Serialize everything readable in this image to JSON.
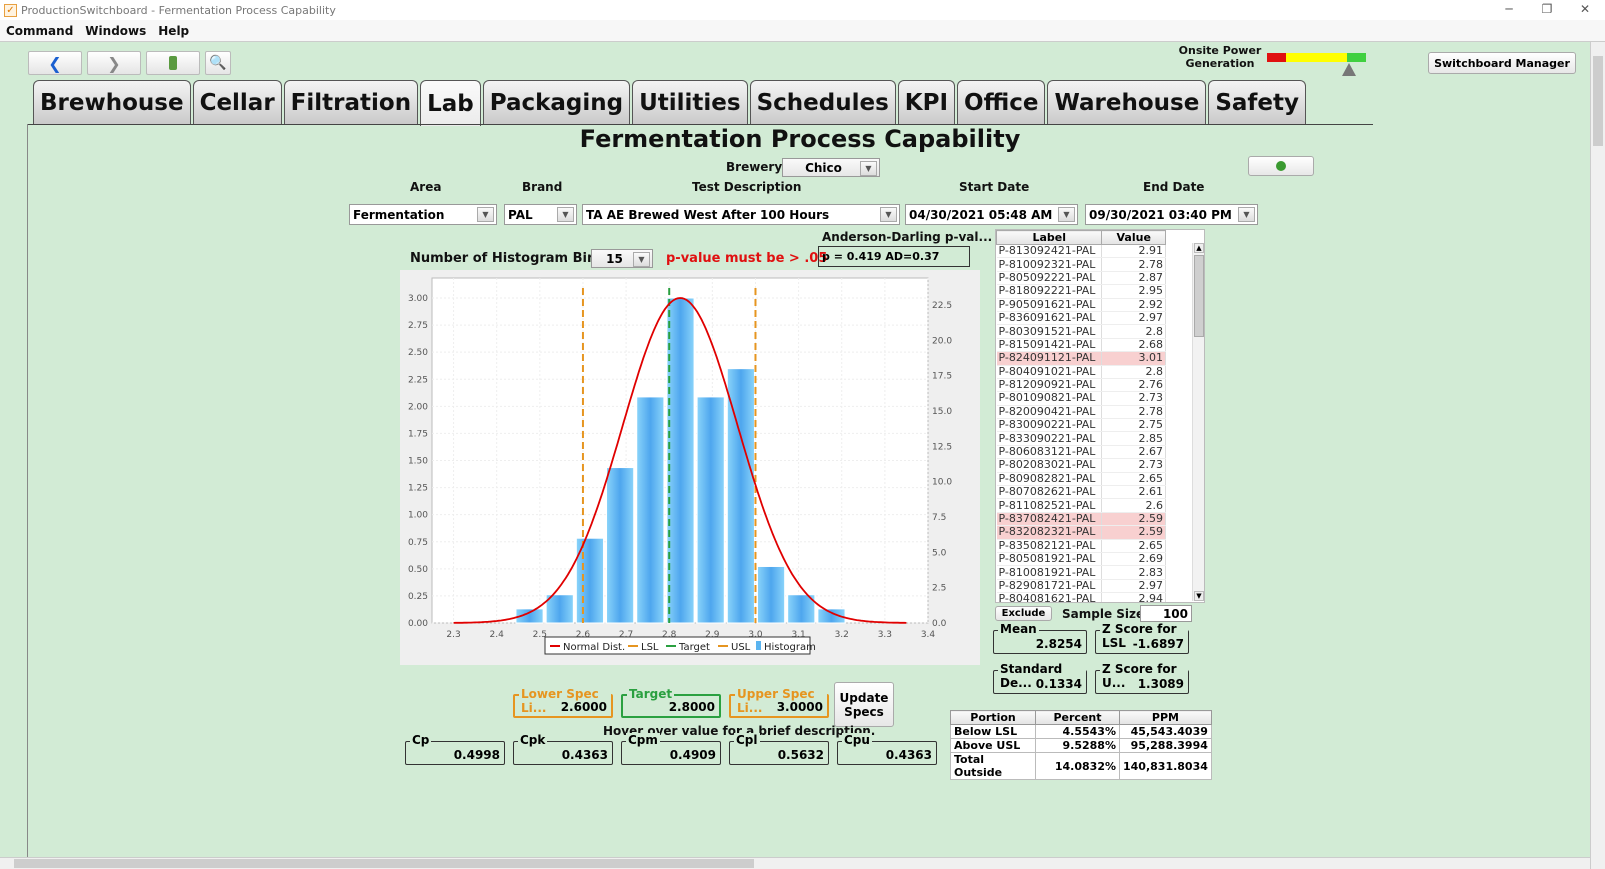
{
  "window": {
    "title": "ProductionSwitchboard - Fermentation Process Capability"
  },
  "menu": [
    "Command",
    "Windows",
    "Help"
  ],
  "toolbar": {
    "back_icon": "back-arrow-icon",
    "forward_icon": "forward-arrow-icon",
    "battery_icon": "battery-icon",
    "search_icon": "magnifier-icon"
  },
  "power": {
    "label_line1": "Onsite Power",
    "label_line2": "Generation",
    "level_fraction": 0.83
  },
  "switchboard_manager": "Switchboard Manager",
  "tabs": [
    "Brewhouse",
    "Cellar",
    "Filtration",
    "Lab",
    "Packaging",
    "Utilities",
    "Schedules",
    "KPI",
    "Office",
    "Warehouse",
    "Safety"
  ],
  "active_tab": "Lab",
  "page_title": "Fermentation Process Capability",
  "filters": {
    "brewery_label": "Brewery",
    "brewery_value": "Chico",
    "area_label": "Area",
    "area_value": "Fermentation",
    "brand_label": "Brand",
    "brand_value": "PAL",
    "test_label": "Test Description",
    "test_value": "TA AE Brewed West After 100 Hours",
    "start_label": "Start Date",
    "start_value": "04/30/2021 05:48 AM",
    "end_label": "End Date",
    "end_value": "09/30/2021 03:40 PM"
  },
  "bins": {
    "label": "Number of Histogram Bins:",
    "value": "15"
  },
  "pvalue_warning": "p-value must be > .05",
  "ad": {
    "label": "Anderson-Darling p-val...",
    "value": "p = 0.419 AD=0.37"
  },
  "chart_data": {
    "type": "bar",
    "title": "",
    "xlabel": "",
    "ylabel": "",
    "x_ticks": [
      "2.3",
      "2.4",
      "2.5",
      "2.6",
      "2.7",
      "2.8",
      "2.9",
      "3.0",
      "3.1",
      "3.2",
      "3.3",
      "3.4"
    ],
    "xlim": [
      2.25,
      3.4
    ],
    "y_left_ticks": [
      "0.00",
      "0.25",
      "0.50",
      "0.75",
      "1.00",
      "1.25",
      "1.50",
      "1.75",
      "2.00",
      "2.25",
      "2.50",
      "2.75",
      "3.00"
    ],
    "ylim_left": [
      0,
      3.0
    ],
    "y_right_ticks": [
      "0.0",
      "2.5",
      "5.0",
      "7.5",
      "10.0",
      "12.5",
      "15.0",
      "17.5",
      "20.0",
      "22.5"
    ],
    "ylim_right": [
      0,
      23.0
    ],
    "histogram": {
      "bin_starts": [
        2.44,
        2.51,
        2.58,
        2.65,
        2.72,
        2.79,
        2.86,
        2.93,
        3.0,
        3.07,
        3.14
      ],
      "bin_width": 0.07,
      "heights": [
        1,
        2,
        6,
        11,
        16,
        23,
        16,
        18,
        4,
        2,
        1
      ]
    },
    "normal": {
      "mean": 2.8254,
      "sd": 0.1334,
      "peak_left_axis": 3.0
    },
    "lsl": 2.6,
    "target": 2.8,
    "usl": 3.0,
    "legend": [
      "Normal Dist.",
      "LSL",
      "Target",
      "USL",
      "Histogram"
    ],
    "legend_position": "bottom",
    "grid": true,
    "colors": {
      "normal": "#e00000",
      "lsl": "#e69520",
      "target": "#2aa040",
      "usl": "#e69520",
      "bar": "#5ab4f0"
    }
  },
  "table": {
    "headers": [
      "Label",
      "Value"
    ],
    "rows": [
      {
        "label": "P-813092421-PAL",
        "value": "2.91",
        "hl": false
      },
      {
        "label": "P-810092321-PAL",
        "value": "2.78",
        "hl": false
      },
      {
        "label": "P-805092221-PAL",
        "value": "2.87",
        "hl": false
      },
      {
        "label": "P-818092221-PAL",
        "value": "2.95",
        "hl": false
      },
      {
        "label": "P-905091621-PAL",
        "value": "2.92",
        "hl": false
      },
      {
        "label": "P-836091621-PAL",
        "value": "2.97",
        "hl": false
      },
      {
        "label": "P-803091521-PAL",
        "value": "2.8",
        "hl": false
      },
      {
        "label": "P-815091421-PAL",
        "value": "2.68",
        "hl": false
      },
      {
        "label": "P-824091121-PAL",
        "value": "3.01",
        "hl": true
      },
      {
        "label": "P-804091021-PAL",
        "value": "2.8",
        "hl": false
      },
      {
        "label": "P-812090921-PAL",
        "value": "2.76",
        "hl": false
      },
      {
        "label": "P-801090821-PAL",
        "value": "2.73",
        "hl": false
      },
      {
        "label": "P-820090421-PAL",
        "value": "2.78",
        "hl": false
      },
      {
        "label": "P-830090221-PAL",
        "value": "2.75",
        "hl": false
      },
      {
        "label": "P-833090221-PAL",
        "value": "2.85",
        "hl": false
      },
      {
        "label": "P-806083121-PAL",
        "value": "2.67",
        "hl": false
      },
      {
        "label": "P-802083021-PAL",
        "value": "2.73",
        "hl": false
      },
      {
        "label": "P-809082821-PAL",
        "value": "2.65",
        "hl": false
      },
      {
        "label": "P-807082621-PAL",
        "value": "2.61",
        "hl": false
      },
      {
        "label": "P-811082521-PAL",
        "value": "2.6",
        "hl": false
      },
      {
        "label": "P-837082421-PAL",
        "value": "2.59",
        "hl": true
      },
      {
        "label": "P-832082321-PAL",
        "value": "2.59",
        "hl": true
      },
      {
        "label": "P-835082121-PAL",
        "value": "2.65",
        "hl": false
      },
      {
        "label": "P-805081921-PAL",
        "value": "2.69",
        "hl": false
      },
      {
        "label": "P-810081921-PAL",
        "value": "2.83",
        "hl": false
      },
      {
        "label": "P-829081721-PAL",
        "value": "2.97",
        "hl": false
      },
      {
        "label": "P-804081621-PAL",
        "value": "2.94",
        "hl": false
      }
    ]
  },
  "exclude_label": "Exclude",
  "sample_size": {
    "label": "Sample Size:",
    "value": "100"
  },
  "stats": {
    "mean": {
      "label": "Mean",
      "value": "2.8254"
    },
    "z_lsl": {
      "label": "Z Score for LSL",
      "value": "-1.6897"
    },
    "stdev": {
      "label": "Standard De...",
      "value": "0.1334"
    },
    "z_usl": {
      "label": "Z Score for U...",
      "value": "1.3089"
    }
  },
  "specs": {
    "lsl": {
      "label": "Lower Spec Li...",
      "value": "2.6000"
    },
    "target": {
      "label": "Target",
      "value": "2.8000"
    },
    "usl": {
      "label": "Upper Spec Li...",
      "value": "3.0000"
    },
    "update_label_1": "Update",
    "update_label_2": "Specs"
  },
  "hover_hint": "Hover over value for a brief description.",
  "capability": [
    {
      "label": "Cp",
      "value": "0.4998"
    },
    {
      "label": "Cpk",
      "value": "0.4363"
    },
    {
      "label": "Cpm",
      "value": "0.4909"
    },
    {
      "label": "Cpl",
      "value": "0.5632"
    },
    {
      "label": "Cpu",
      "value": "0.4363"
    }
  ],
  "summary": {
    "headers": [
      "Portion",
      "Percent",
      "PPM"
    ],
    "rows": [
      [
        "Below LSL",
        "4.5543%",
        "45,543.4039"
      ],
      [
        "Above USL",
        "9.5288%",
        "95,288.3994"
      ],
      [
        "Total Outside",
        "14.0832%",
        "140,831.8034"
      ]
    ]
  }
}
